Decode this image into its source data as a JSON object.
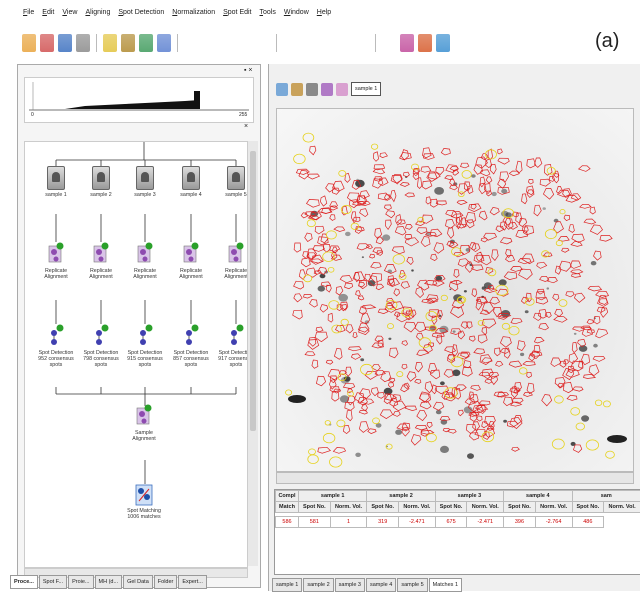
{
  "menu": [
    "File",
    "Edit",
    "View",
    "Aligning",
    "Spot Detection",
    "Normalization",
    "Spot Edit",
    "Tools",
    "Window",
    "Help"
  ],
  "figure_label": "(a)",
  "toolbar_icons": [
    "open-icon",
    "save-icon",
    "disk-icon",
    "undo-icon",
    "bulb-icon",
    "grid-icon",
    "globe-icon",
    "refresh-icon",
    "lens-icon",
    "camera-icon",
    "gel-icon",
    "tools-icon",
    "circle-icon",
    "circle-icon",
    "circle-icon",
    "image-icon",
    "crop-icon",
    "paint-icon",
    "pointer-icon",
    "crosshair-icon",
    "spot-icon",
    "marker-icon"
  ],
  "histogram": {
    "min_label": "0",
    "max_label": "255"
  },
  "pipeline": {
    "samples": [
      {
        "name": "sample 1",
        "sd": "Spot Detection",
        "count": "952 consensus",
        "unit": "spots"
      },
      {
        "name": "sample 2",
        "sd": "Spot Detection",
        "count": "798 consensus",
        "unit": "spots"
      },
      {
        "name": "sample 3",
        "sd": "Spot Detection",
        "count": "915 consensus",
        "unit": "spots"
      },
      {
        "name": "sample 4",
        "sd": "Spot Detection",
        "count": "857 consensus",
        "unit": "spots"
      },
      {
        "name": "sample 5",
        "sd": "Spot Detection",
        "count": "917 consensus",
        "unit": "spots"
      }
    ],
    "replicate": [
      "Replicate",
      "Alignment"
    ],
    "sample_alignment": [
      "Sample",
      "Alignment"
    ],
    "spot_matching": [
      "Spot Matching",
      "1006 matches"
    ]
  },
  "left_tabs": [
    "Proce...",
    "Spot F...",
    "Proie...",
    "MH (d...",
    "Gel Data",
    "Folder",
    "Expert..."
  ],
  "view_tab": "sample 1",
  "table": {
    "corner": "Compl",
    "corner2": "Match",
    "groups": [
      "sample 1",
      "sample 2",
      "sample 3",
      "sample 4",
      "sam"
    ],
    "subheaders": [
      "Spot No.",
      "Norm. Vol."
    ],
    "row": [
      "586",
      "581",
      "1",
      "319",
      "-2.471",
      "675",
      "-2.471",
      "396",
      "-2.764",
      "486"
    ]
  },
  "right_tabs": [
    "sample 1",
    "sample 2",
    "sample 3",
    "sample 4",
    "sample 5",
    "Matches 1"
  ]
}
